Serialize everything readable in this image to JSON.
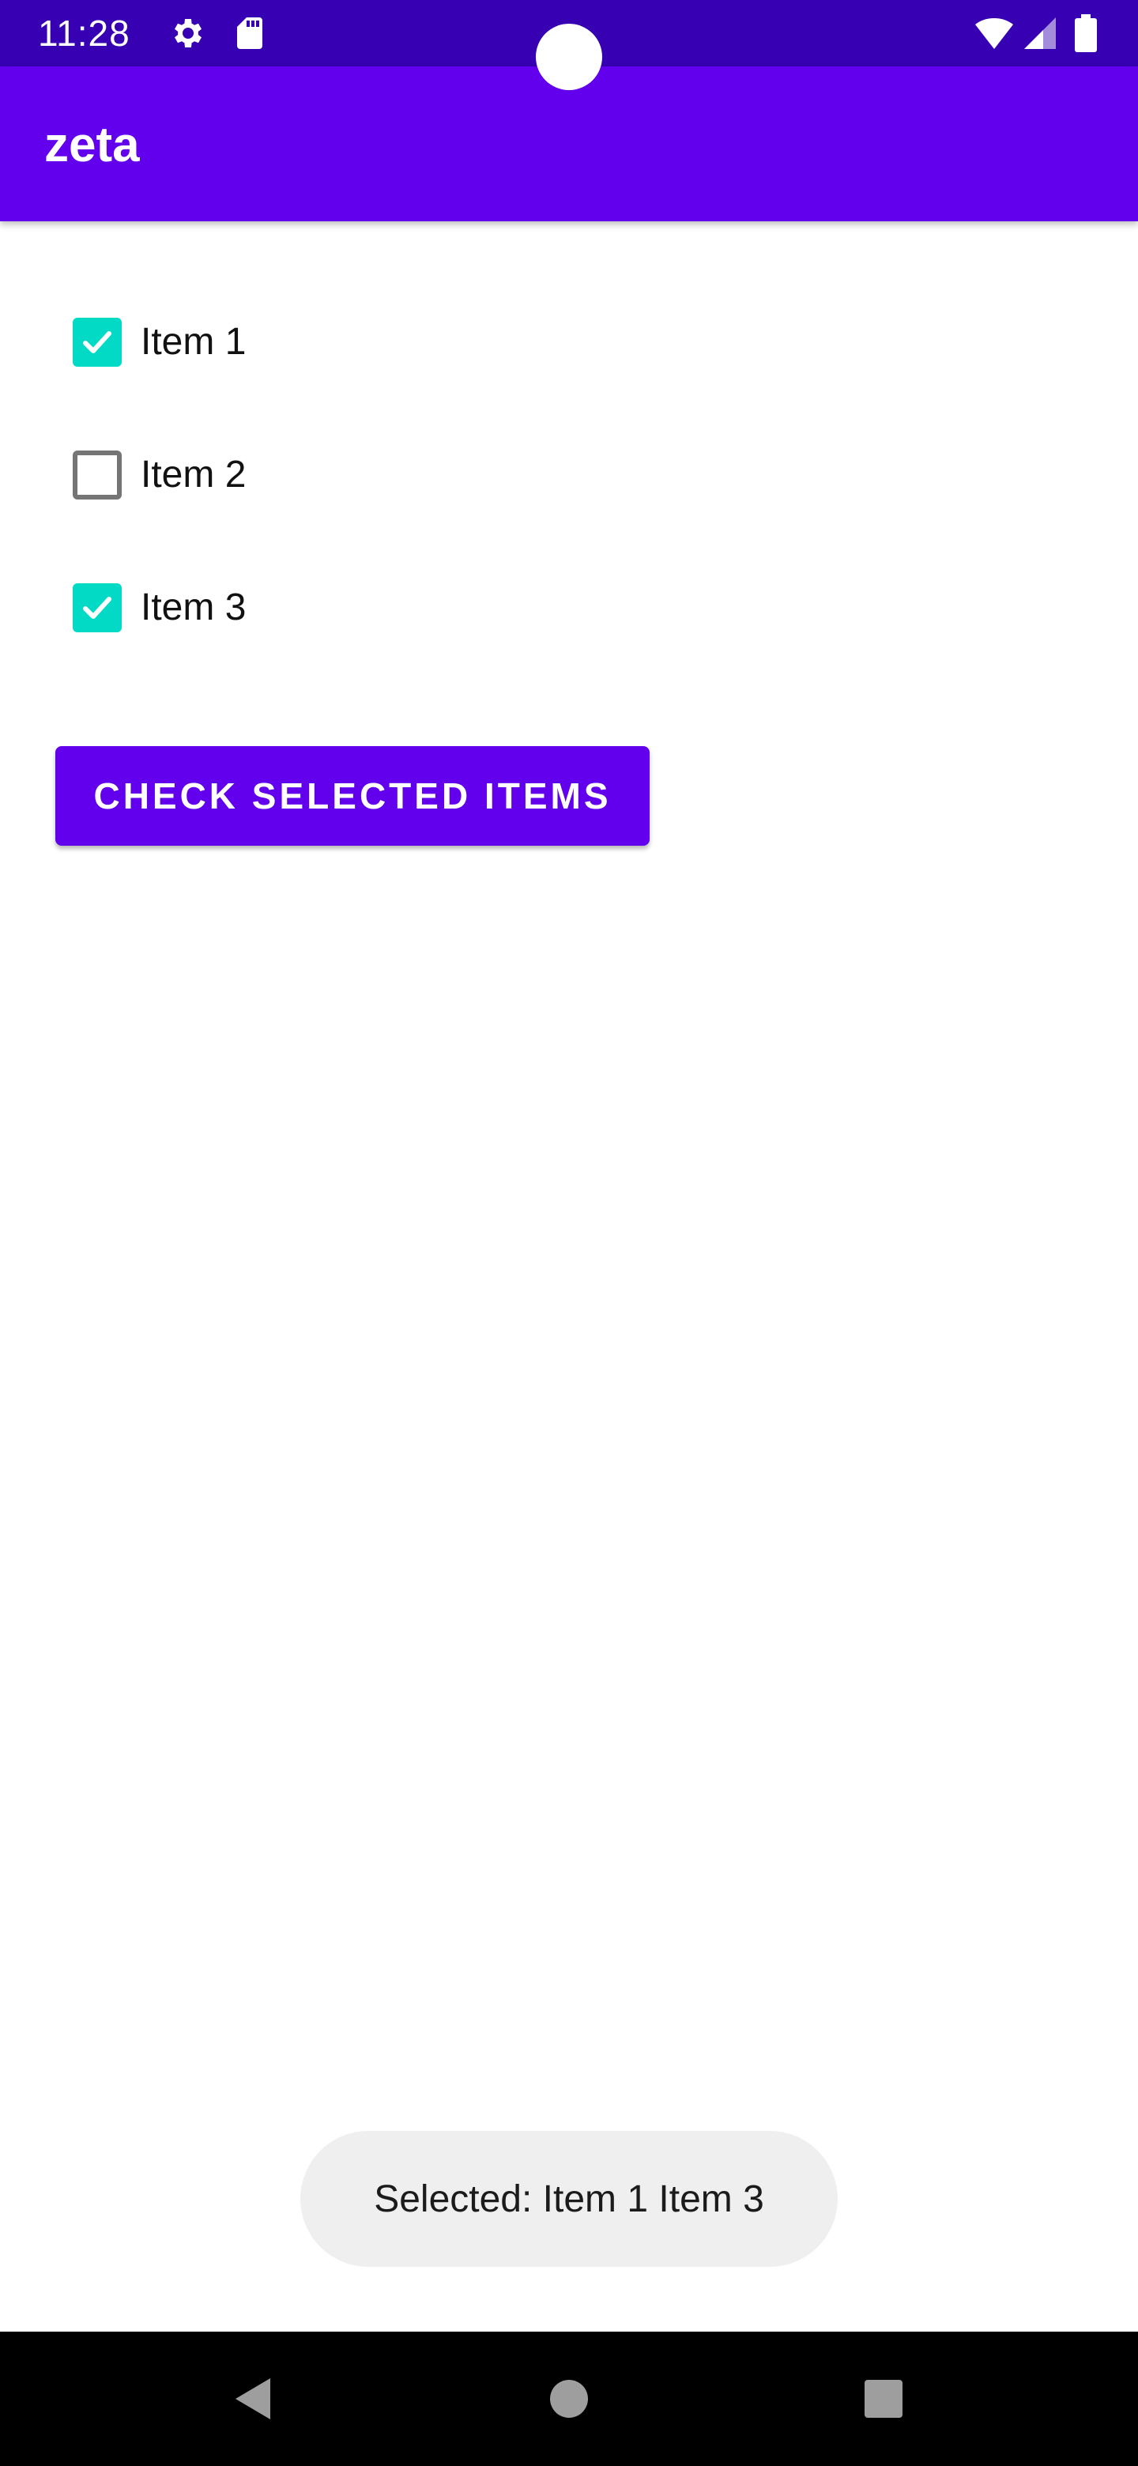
{
  "status_bar": {
    "time": "11:28",
    "icons": [
      "settings-icon",
      "sd-card-icon",
      "wifi-icon",
      "signal-icon",
      "battery-icon"
    ]
  },
  "app_bar": {
    "title": "zeta"
  },
  "checklist": {
    "items": [
      {
        "label": "Item 1",
        "checked": true
      },
      {
        "label": "Item 2",
        "checked": false
      },
      {
        "label": "Item 3",
        "checked": true
      }
    ]
  },
  "button": {
    "label": "CHECK SELECTED ITEMS"
  },
  "toast": {
    "message": "Selected: Item 1 Item 3"
  },
  "nav_bar": {
    "icons": [
      "back-icon",
      "home-icon",
      "recents-icon"
    ]
  },
  "colors": {
    "status_bar": "#3700b3",
    "primary": "#6200ee",
    "accent": "#03dac5",
    "toast_bg": "#efefef"
  }
}
